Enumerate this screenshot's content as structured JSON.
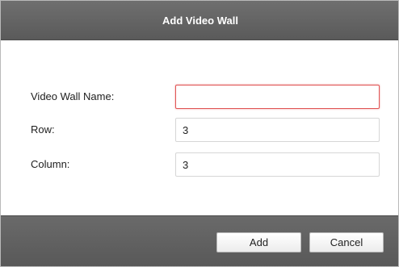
{
  "dialog": {
    "title": "Add Video Wall",
    "accent_color": "#e05555",
    "titlebar_color": "#666666"
  },
  "form": {
    "name_label": "Video Wall Name:",
    "name_value": "",
    "row_label": "Row:",
    "row_value": "3",
    "column_label": "Column:",
    "column_value": "3"
  },
  "footer": {
    "add_label": "Add",
    "cancel_label": "Cancel"
  }
}
